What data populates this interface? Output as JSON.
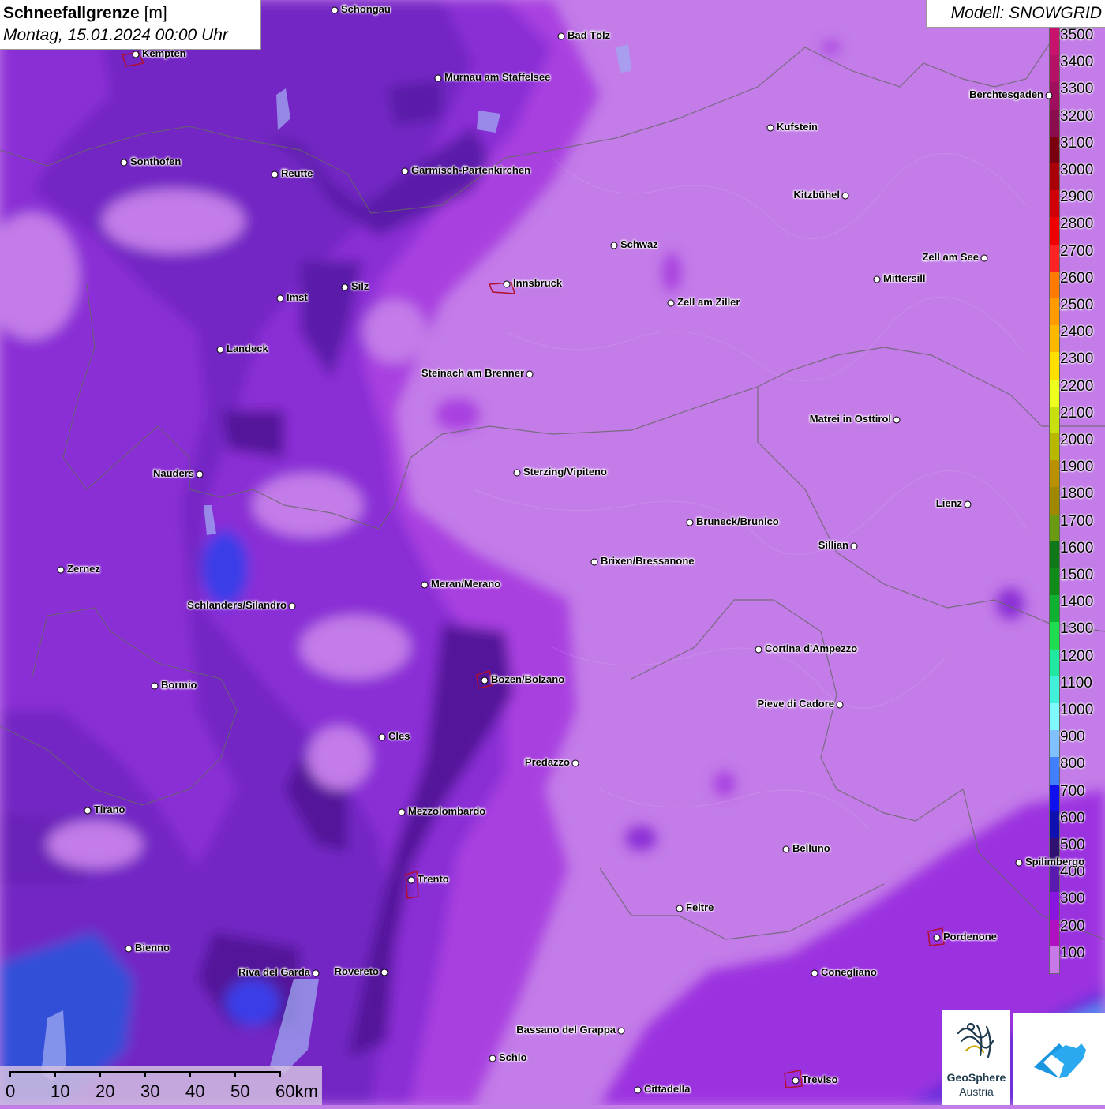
{
  "title": {
    "main": "Schneefallgrenze",
    "unit": " [m]",
    "date": "Montag, 15.01.2024 00:00 Uhr"
  },
  "model": {
    "label": "Modell: SNOWGRID"
  },
  "legend": {
    "levels": [
      "3500",
      "3400",
      "3300",
      "3200",
      "3100",
      "3000",
      "2900",
      "2800",
      "2700",
      "2600",
      "2500",
      "2400",
      "2300",
      "2200",
      "2100",
      "2000",
      "1900",
      "1800",
      "1700",
      "1600",
      "1500",
      "1400",
      "1300",
      "1200",
      "1100",
      "1000",
      "900",
      "800",
      "700",
      "600",
      "500",
      "400",
      "300",
      "200",
      "100"
    ],
    "colors": [
      "#c8136e",
      "#b51166",
      "#a00f5e",
      "#8b0d4f",
      "#7a0010",
      "#aa0008",
      "#d00008",
      "#ee0000",
      "#ff2222",
      "#ff7a00",
      "#ff9a00",
      "#ffb800",
      "#ffe000",
      "#eeff20",
      "#c8e010",
      "#b8b800",
      "#b89000",
      "#a08800",
      "#6a9a10",
      "#107818",
      "#108a18",
      "#10b030",
      "#20dd50",
      "#20e8a0",
      "#40f0d8",
      "#80f8ff",
      "#80c0ff",
      "#4080ff",
      "#1010ee",
      "#1010b0",
      "#301070",
      "#5a1ab0",
      "#8a14e0",
      "#b010c0",
      "#c878e8"
    ]
  },
  "cities": [
    {
      "name": "Schongau",
      "label_side": "right"
    },
    {
      "name": "Bad Tölz",
      "label_side": "right"
    },
    {
      "name": "Kempten",
      "label_side": "right"
    },
    {
      "name": "Murnau am Staffelsee",
      "label_side": "right"
    },
    {
      "name": "Berchtesgaden",
      "label_side": "left"
    },
    {
      "name": "Kufstein",
      "label_side": "right"
    },
    {
      "name": "Sonthofen",
      "label_side": "right"
    },
    {
      "name": "Reutte",
      "label_side": "right"
    },
    {
      "name": "Garmisch-Partenkirchen",
      "label_side": "right"
    },
    {
      "name": "Kitzbühel",
      "label_side": "left"
    },
    {
      "name": "Schwaz",
      "label_side": "right"
    },
    {
      "name": "Zell am See",
      "label_side": "left"
    },
    {
      "name": "Innsbruck",
      "label_side": "right"
    },
    {
      "name": "Mittersill",
      "label_side": "right"
    },
    {
      "name": "Silz",
      "label_side": "right"
    },
    {
      "name": "Imst",
      "label_side": "right"
    },
    {
      "name": "Zell am Ziller",
      "label_side": "right"
    },
    {
      "name": "Landeck",
      "label_side": "right"
    },
    {
      "name": "Steinach am Brenner",
      "label_side": "left"
    },
    {
      "name": "Matrei in Osttirol",
      "label_side": "left"
    },
    {
      "name": "Nauders",
      "label_side": "left"
    },
    {
      "name": "Sterzing/Vipiteno",
      "label_side": "right"
    },
    {
      "name": "Lienz",
      "label_side": "left"
    },
    {
      "name": "Bruneck/Brunico",
      "label_side": "right"
    },
    {
      "name": "Sillian",
      "label_side": "left"
    },
    {
      "name": "Brixen/Bressanone",
      "label_side": "right"
    },
    {
      "name": "Zernez",
      "label_side": "right"
    },
    {
      "name": "Meran/Merano",
      "label_side": "right"
    },
    {
      "name": "Schlanders/Silandro",
      "label_side": "left"
    },
    {
      "name": "Cortina d'Ampezzo",
      "label_side": "right"
    },
    {
      "name": "Bozen/Bolzano",
      "label_side": "right"
    },
    {
      "name": "Bormio",
      "label_side": "right"
    },
    {
      "name": "Pieve di Cadore",
      "label_side": "left"
    },
    {
      "name": "Cles",
      "label_side": "right"
    },
    {
      "name": "Predazzo",
      "label_side": "left"
    },
    {
      "name": "Tirano",
      "label_side": "right"
    },
    {
      "name": "Mezzolombardo",
      "label_side": "right"
    },
    {
      "name": "Belluno",
      "label_side": "right"
    },
    {
      "name": "Spilimbergo",
      "label_side": "right"
    },
    {
      "name": "Trento",
      "label_side": "right"
    },
    {
      "name": "Feltre",
      "label_side": "right"
    },
    {
      "name": "Pordenone",
      "label_side": "right"
    },
    {
      "name": "Bienno",
      "label_side": "right"
    },
    {
      "name": "Riva del Garda",
      "label_side": "left"
    },
    {
      "name": "Rovereto",
      "label_side": "left"
    },
    {
      "name": "Conegliano",
      "label_side": "right"
    },
    {
      "name": "Bassano del Grappa",
      "label_side": "left"
    },
    {
      "name": "Schio",
      "label_side": "right"
    },
    {
      "name": "Treviso",
      "label_side": "right"
    },
    {
      "name": "Cittadella",
      "label_side": "right"
    }
  ],
  "scalebar": {
    "labels": [
      "0",
      "10",
      "20",
      "30",
      "40",
      "50",
      "60km"
    ]
  },
  "logos": {
    "geosphere_line1": "GeoSphere",
    "geosphere_line2": "Austria"
  }
}
